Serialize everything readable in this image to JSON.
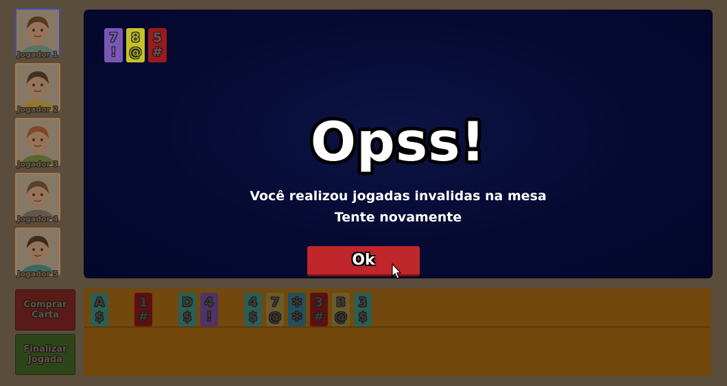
{
  "players": [
    {
      "name": "Jogador 1",
      "active": true,
      "skin": "#f0b78f",
      "hair": "#5b3512",
      "shirt": "#6ab3a5"
    },
    {
      "name": "Jogador 2",
      "active": false,
      "skin": "#f0b78f",
      "hair": "#3a2314",
      "shirt": "#e8c13b"
    },
    {
      "name": "Jogador 3",
      "active": false,
      "skin": "#f0b78f",
      "hair": "#c8521a",
      "shirt": "#6a9e3a"
    },
    {
      "name": "Jogador 4",
      "active": false,
      "skin": "#f0b78f",
      "hair": "#6a4526",
      "shirt": "#7b7b7b"
    },
    {
      "name": "Jogador 5",
      "active": false,
      "skin": "#f0b78f",
      "hair": "#2b1a10",
      "shirt": "#2e9e9e"
    }
  ],
  "buttons": {
    "buy_line1": "Comprar",
    "buy_line2": "Carta",
    "end_line1": "Finalizar",
    "end_line2": "Jogada"
  },
  "table_group": [
    {
      "top": "7",
      "bottom": "!",
      "color": "purple"
    },
    {
      "top": "8",
      "bottom": "@",
      "color": "yellow"
    },
    {
      "top": "5",
      "bottom": "#",
      "color": "red"
    }
  ],
  "hand": [
    {
      "top": "A",
      "bottom": "$",
      "color": "teal"
    },
    {
      "top": "1",
      "bottom": "#",
      "color": "red"
    },
    {
      "top": "D",
      "bottom": "$",
      "color": "teal"
    },
    {
      "top": "4",
      "bottom": "!",
      "color": "purple"
    },
    {
      "top": "4",
      "bottom": "$",
      "color": "teal"
    },
    {
      "top": "7",
      "bottom": "@",
      "color": "sand"
    },
    {
      "top": "✻",
      "bottom": "✻",
      "color": "cyan"
    },
    {
      "top": "3",
      "bottom": "#",
      "color": "red"
    },
    {
      "top": "B",
      "bottom": "@",
      "color": "sand"
    },
    {
      "top": "3",
      "bottom": "$",
      "color": "teal"
    }
  ],
  "modal": {
    "title": "Opss!",
    "line1": "Você realizou jogadas invalidas na mesa",
    "line2": "Tente novamente",
    "ok_label": "Ok"
  }
}
